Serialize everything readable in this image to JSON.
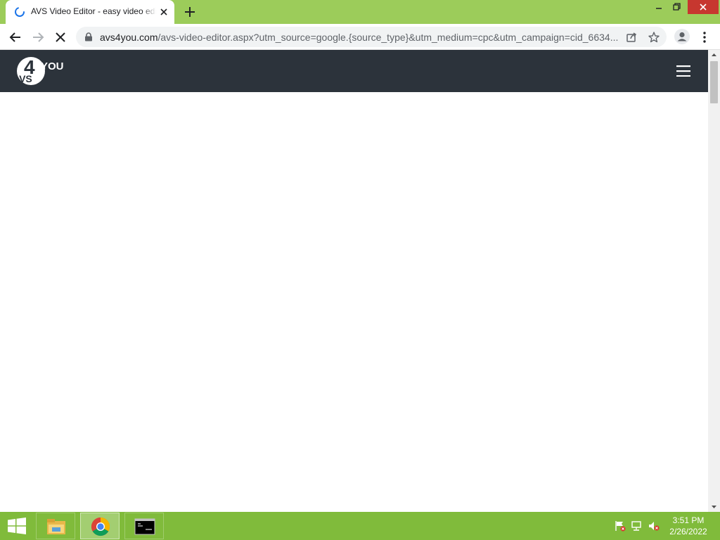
{
  "browser": {
    "tab": {
      "title": "AVS Video Editor - easy video editing"
    },
    "url": {
      "host": "avs4you.com",
      "path": "/avs-video-editor.aspx?utm_source=google.{source_type}&utm_medium=cpc&utm_campaign=cid_6634..."
    }
  },
  "site": {
    "logo": {
      "prefix": "AVS",
      "number": "4",
      "suffix": "YOU"
    }
  },
  "taskbar": {
    "clock": {
      "time": "3:51 PM",
      "date": "2/26/2022"
    },
    "apps": [
      "file-explorer",
      "chrome",
      "command-prompt"
    ]
  },
  "colors": {
    "tabstrip": "#9ccc5a",
    "site_header": "#2c333b",
    "taskbar": "#80bb3b",
    "window_close": "#c7372f"
  }
}
